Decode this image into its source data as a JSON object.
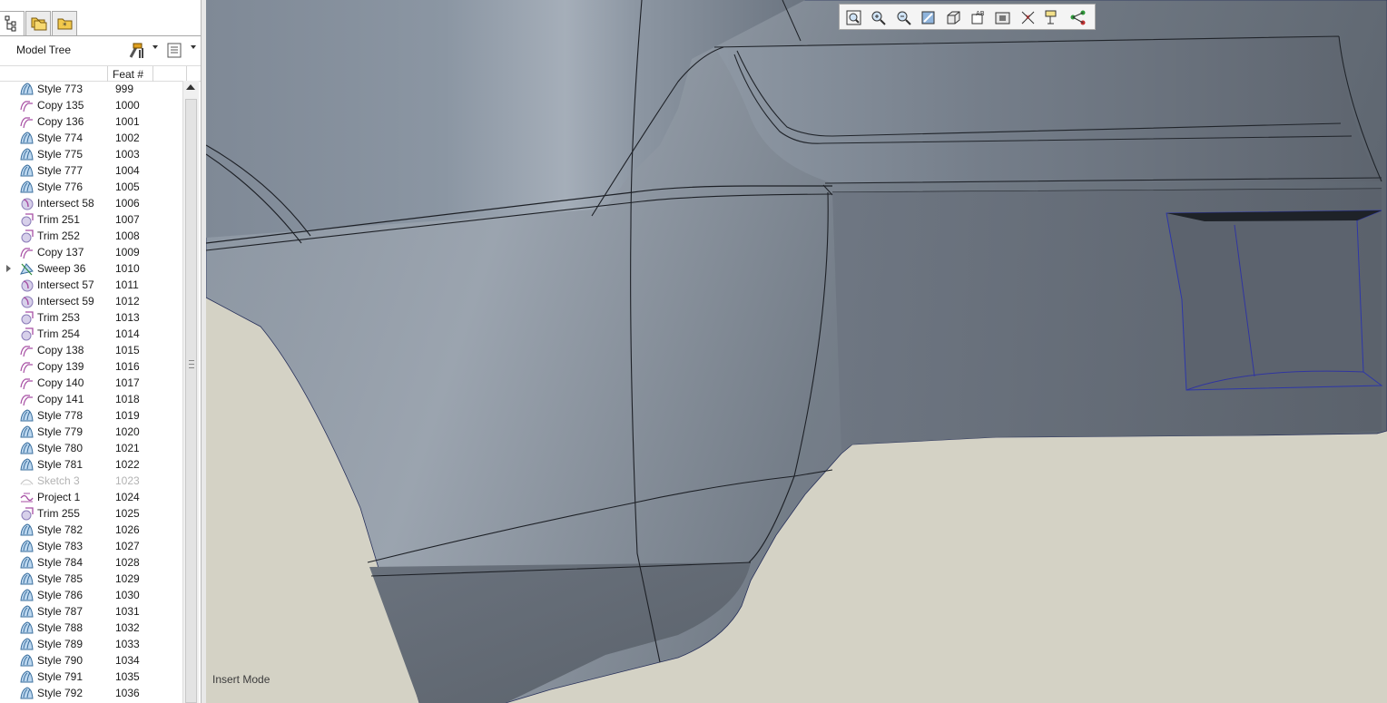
{
  "panel": {
    "tabs": [
      {
        "name": "model-tree-tab",
        "icon": "model-tree-icon",
        "active": true
      },
      {
        "name": "folder-browser-tab",
        "icon": "folder-icon",
        "active": false
      },
      {
        "name": "favorites-tab",
        "icon": "favorites-icon",
        "active": false
      }
    ],
    "title": "Model Tree",
    "settings_icon": "tree-settings-icon",
    "columns_icon": "tree-columns-icon",
    "column_feat": "Feat #"
  },
  "tree": {
    "rows": [
      {
        "name": "Style 773",
        "feat": "999",
        "icon": "style"
      },
      {
        "name": "Copy 135",
        "feat": "1000",
        "icon": "copy"
      },
      {
        "name": "Copy 136",
        "feat": "1001",
        "icon": "copy"
      },
      {
        "name": "Style 774",
        "feat": "1002",
        "icon": "style"
      },
      {
        "name": "Style 775",
        "feat": "1003",
        "icon": "style"
      },
      {
        "name": "Style 777",
        "feat": "1004",
        "icon": "style"
      },
      {
        "name": "Style 776",
        "feat": "1005",
        "icon": "style"
      },
      {
        "name": "Intersect 58",
        "feat": "1006",
        "icon": "intersect"
      },
      {
        "name": "Trim 251",
        "feat": "1007",
        "icon": "trim"
      },
      {
        "name": "Trim 252",
        "feat": "1008",
        "icon": "trim"
      },
      {
        "name": "Copy 137",
        "feat": "1009",
        "icon": "copy"
      },
      {
        "name": "Sweep 36",
        "feat": "1010",
        "icon": "sweep",
        "expandable": true
      },
      {
        "name": "Intersect 57",
        "feat": "1011",
        "icon": "intersect"
      },
      {
        "name": "Intersect 59",
        "feat": "1012",
        "icon": "intersect"
      },
      {
        "name": "Trim 253",
        "feat": "1013",
        "icon": "trim"
      },
      {
        "name": "Trim 254",
        "feat": "1014",
        "icon": "trim"
      },
      {
        "name": "Copy 138",
        "feat": "1015",
        "icon": "copy"
      },
      {
        "name": "Copy 139",
        "feat": "1016",
        "icon": "copy"
      },
      {
        "name": "Copy 140",
        "feat": "1017",
        "icon": "copy"
      },
      {
        "name": "Copy 141",
        "feat": "1018",
        "icon": "copy"
      },
      {
        "name": "Style 778",
        "feat": "1019",
        "icon": "style"
      },
      {
        "name": "Style 779",
        "feat": "1020",
        "icon": "style"
      },
      {
        "name": "Style 780",
        "feat": "1021",
        "icon": "style"
      },
      {
        "name": "Style 781",
        "feat": "1022",
        "icon": "style"
      },
      {
        "name": "Sketch 3",
        "feat": "1023",
        "icon": "sketch",
        "dim": true
      },
      {
        "name": "Project 1",
        "feat": "1024",
        "icon": "project"
      },
      {
        "name": "Trim 255",
        "feat": "1025",
        "icon": "trim"
      },
      {
        "name": "Style 782",
        "feat": "1026",
        "icon": "style"
      },
      {
        "name": "Style 783",
        "feat": "1027",
        "icon": "style"
      },
      {
        "name": "Style 784",
        "feat": "1028",
        "icon": "style"
      },
      {
        "name": "Style 785",
        "feat": "1029",
        "icon": "style"
      },
      {
        "name": "Style 786",
        "feat": "1030",
        "icon": "style"
      },
      {
        "name": "Style 787",
        "feat": "1031",
        "icon": "style"
      },
      {
        "name": "Style 788",
        "feat": "1032",
        "icon": "style"
      },
      {
        "name": "Style 789",
        "feat": "1033",
        "icon": "style"
      },
      {
        "name": "Style 790",
        "feat": "1034",
        "icon": "style"
      },
      {
        "name": "Style 791",
        "feat": "1035",
        "icon": "style"
      },
      {
        "name": "Style 792",
        "feat": "1036",
        "icon": "style"
      }
    ]
  },
  "view_toolbar": {
    "tools": [
      {
        "name": "refit-button",
        "icon": "refit-icon"
      },
      {
        "name": "zoom-in-button",
        "icon": "zoom-in-icon"
      },
      {
        "name": "zoom-out-button",
        "icon": "zoom-out-icon"
      },
      {
        "name": "repaint-button",
        "icon": "repaint-icon"
      },
      {
        "name": "display-style-button",
        "icon": "display-style-icon"
      },
      {
        "name": "saved-orientations-button",
        "icon": "saved-views-icon"
      },
      {
        "name": "view-manager-button",
        "icon": "view-manager-icon"
      },
      {
        "name": "datum-display-button",
        "icon": "datum-axes-icon"
      },
      {
        "name": "annotation-display-button",
        "icon": "annotation-icon"
      },
      {
        "name": "spin-center-button",
        "icon": "spin-center-icon"
      }
    ]
  },
  "status": {
    "mode": "Insert Mode"
  },
  "colors": {
    "background": "#d4d2c5",
    "surface": "#6c7480",
    "surface_light": "#a3abb5",
    "edge": "#1d2026",
    "feature_icon": "#a64ea3"
  }
}
